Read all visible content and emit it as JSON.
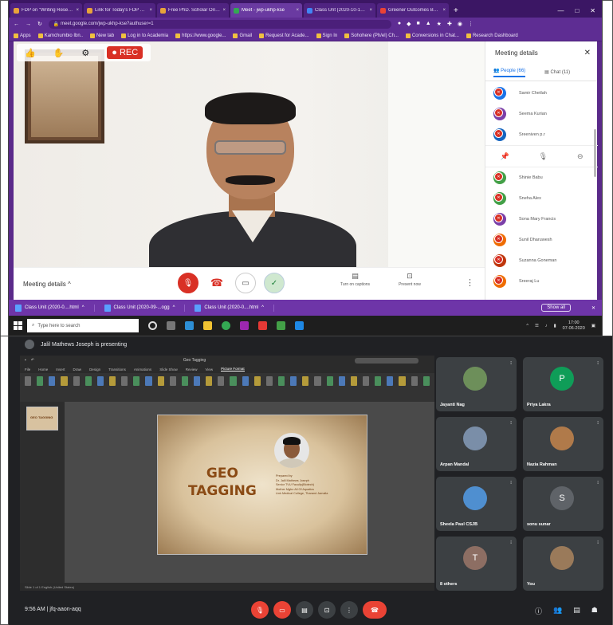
{
  "browser": {
    "tabs": [
      {
        "label": "FDP on \"Writing Research P..."
      },
      {
        "label": "Link for Today's FDP on 'Writ..."
      },
      {
        "label": "Free PhD. Scholar Orientatio..."
      },
      {
        "label": "Meet - jwp-ukhp-kse"
      },
      {
        "label": "Class Unt (2020-10-19) Chi..."
      },
      {
        "label": "Greener Outcomes Based Edu..."
      }
    ],
    "url": "meet.google.com/jwp-ukhp-kse?authuser=1",
    "bookmarks": [
      "Apps",
      "Kamchumbio Ibn..",
      "New tab",
      "Log in to Academia",
      "https://www.google...",
      "Gmail",
      "Request for Acade...",
      "Sign In",
      "Sohohere (Ph/el) Ch...",
      "Conversions in Chat...",
      "Research Dashboard"
    ]
  },
  "meet": {
    "rec_label": "REC",
    "meeting_details": "Meeting details",
    "captions_label": "Turn on captions",
    "present_label": "Present now",
    "panel_title": "Meeting details",
    "people_tab": "People (66)",
    "chat_tab": "Chat (11)",
    "participants_top": [
      {
        "initial": "S",
        "name": "Samir Chetlah",
        "color": "#1a73e8"
      },
      {
        "initial": "S",
        "name": "Seema Kurian",
        "color": "#7b3fa8"
      },
      {
        "initial": "S",
        "name": "Sreeniven p.r",
        "color": "#1565c0"
      }
    ],
    "participants_bottom": [
      {
        "initial": "S",
        "name": "Shinie Babu",
        "color": "#43a047"
      },
      {
        "initial": "S",
        "name": "Sneha Alex",
        "color": "#43a047"
      },
      {
        "initial": "S",
        "name": "Sona Mary Francis",
        "color": "#7b3fa8"
      },
      {
        "initial": "S",
        "name": "Sunil Dharuwesh",
        "color": "#ef6c00"
      },
      {
        "initial": "S",
        "name": "Suzanna Goneman",
        "color": "#bf360c"
      },
      {
        "initial": "S",
        "name": "Sreeraj Lu",
        "color": "#ef6c00"
      }
    ]
  },
  "downloads": {
    "items": [
      "Class Unit (2020-0....html",
      "Class Unit (2020-09-...ogg",
      "Class Unit (2020-0....html"
    ],
    "show_all": "Show all"
  },
  "taskbar": {
    "search_placeholder": "Type here to search",
    "time": "17:00",
    "date": "07-06-2020"
  },
  "presentation": {
    "presenting": "Jalil Mathews Joseph is presenting",
    "window_title": "Geo Tagging",
    "ribbon_tabs": [
      "File",
      "Home",
      "Insert",
      "Draw",
      "Design",
      "Transitions",
      "Animations",
      "Slide Show",
      "Review",
      "View",
      "Picture Format"
    ],
    "slide_title_1": "GEO",
    "slide_title_2": "TAGGING",
    "thumb_label": "GEO TAGGING",
    "credit_lines": [
      "Prepared by",
      "Dr. Jalil Mathews Joseph",
      "Senior TVU Faculty(Biotech)",
      "Mother Mgbo All Of Aquatics",
      "Link Medical College, Tharand Jamaila"
    ],
    "status": "Slide 1 of 1   English (United States)"
  },
  "tiles": [
    {
      "name": "Jayanti Nag",
      "initial": "",
      "color": "#6d8f5a"
    },
    {
      "name": "Priya Lakra",
      "initial": "P",
      "color": "#0f9d58"
    },
    {
      "name": "Arpan Mandal",
      "initial": "",
      "color": "#7a8ea8"
    },
    {
      "name": "Nazia Rahman",
      "initial": "",
      "color": "#b07a4a"
    },
    {
      "name": "Sheela Paul CSJB",
      "initial": "",
      "color": "#4f8fd0"
    },
    {
      "name": "sonu sunar",
      "initial": "S",
      "color": "#5f6368"
    },
    {
      "name": "8 others",
      "initial": "T",
      "color": "#8d6e63"
    },
    {
      "name": "You",
      "initial": "",
      "color": "#9a7a5a"
    }
  ],
  "bottom_bar": {
    "time_code": "9:56 AM | jfq-aaon-aqq"
  }
}
